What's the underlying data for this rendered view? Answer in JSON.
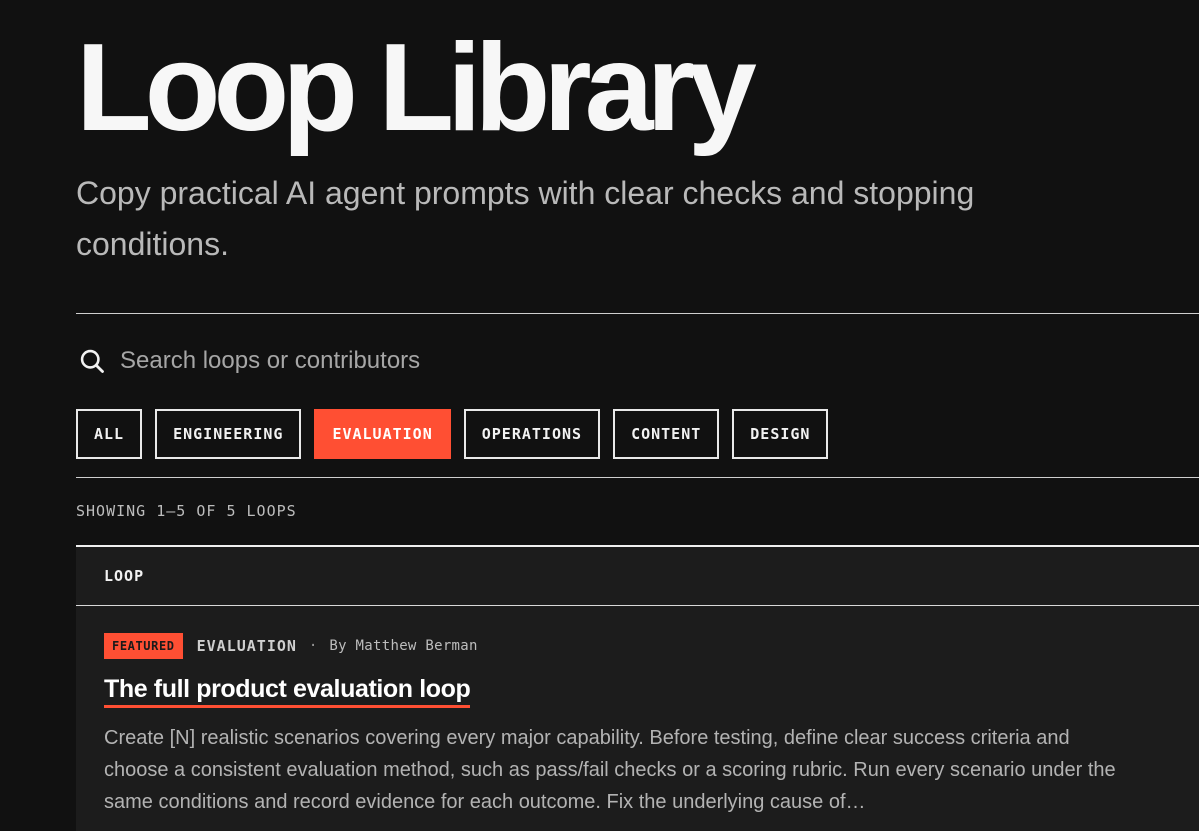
{
  "page": {
    "title": "Loop Library",
    "subtitle": "Copy practical AI agent prompts with clear checks and stopping conditions."
  },
  "search": {
    "placeholder": "Search loops or contributors",
    "icon": "search-icon"
  },
  "filters": [
    {
      "label": "ALL",
      "active": false
    },
    {
      "label": "ENGINEERING",
      "active": false
    },
    {
      "label": "EVALUATION",
      "active": true
    },
    {
      "label": "OPERATIONS",
      "active": false
    },
    {
      "label": "CONTENT",
      "active": false
    },
    {
      "label": "DESIGN",
      "active": false
    }
  ],
  "results": {
    "count_text": "SHOWING 1–5 OF 5 LOOPS"
  },
  "table": {
    "header": "LOOP",
    "rows": [
      {
        "badge": "FEATURED",
        "category": "EVALUATION",
        "separator": "·",
        "author": "By Matthew Berman",
        "title": "The full product evaluation loop",
        "description": "Create [N] realistic scenarios covering every major capability. Before testing, define clear success criteria and choose a consistent evaluation method, such as pass/fail checks or a scoring rubric. Run every scenario under the same conditions and record evidence for each outcome. Fix the underlying cause of…"
      }
    ]
  },
  "colors": {
    "background": "#111111",
    "accent": "#ff4f33",
    "table_bg": "#1c1c1c"
  }
}
